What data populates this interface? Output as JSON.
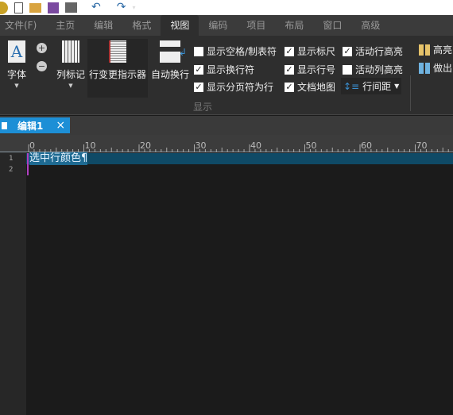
{
  "quick_access": {
    "icons": [
      "app-logo-icon",
      "new-file-icon",
      "open-folder-icon",
      "save-icon",
      "print-icon",
      "undo-icon",
      "redo-icon",
      "customize-dropdown-icon"
    ]
  },
  "menu_tabs": [
    {
      "label": "文件(F)"
    },
    {
      "label": "主页"
    },
    {
      "label": "编辑"
    },
    {
      "label": "格式"
    },
    {
      "label": "视图",
      "active": true
    },
    {
      "label": "编码"
    },
    {
      "label": "项目"
    },
    {
      "label": "布局"
    },
    {
      "label": "窗口"
    },
    {
      "label": "高级"
    }
  ],
  "ribbon": {
    "font_label": "字体",
    "column_marker_label": "列标记",
    "change_indicator_label": "行变更指示器",
    "word_wrap_label": "自动换行",
    "checks": [
      {
        "label": "显示空格/制表符",
        "checked": false
      },
      {
        "label": "显示换行符",
        "checked": true
      },
      {
        "label": "显示分页符为行",
        "checked": true
      },
      {
        "label": "显示标尺",
        "checked": true
      },
      {
        "label": "显示行号",
        "checked": true
      },
      {
        "label": "文档地图",
        "checked": true
      },
      {
        "label": "活动行高亮",
        "checked": true
      },
      {
        "label": "活动列高亮",
        "checked": false
      }
    ],
    "line_spacing_label": "行间距",
    "highlight_label": "高亮",
    "make_label": "做出",
    "group_label": "显示"
  },
  "doc_tab": {
    "label": "编辑1",
    "close": "×"
  },
  "ruler": {
    "labels": [
      "0",
      "10",
      "20",
      "30",
      "40",
      "50",
      "60",
      "70"
    ]
  },
  "editor": {
    "line_numbers": [
      "1",
      "2"
    ],
    "lines": [
      "选中行颜色¶"
    ],
    "active_line_color": "#0f4a66",
    "accent": "#1d8fd6"
  }
}
